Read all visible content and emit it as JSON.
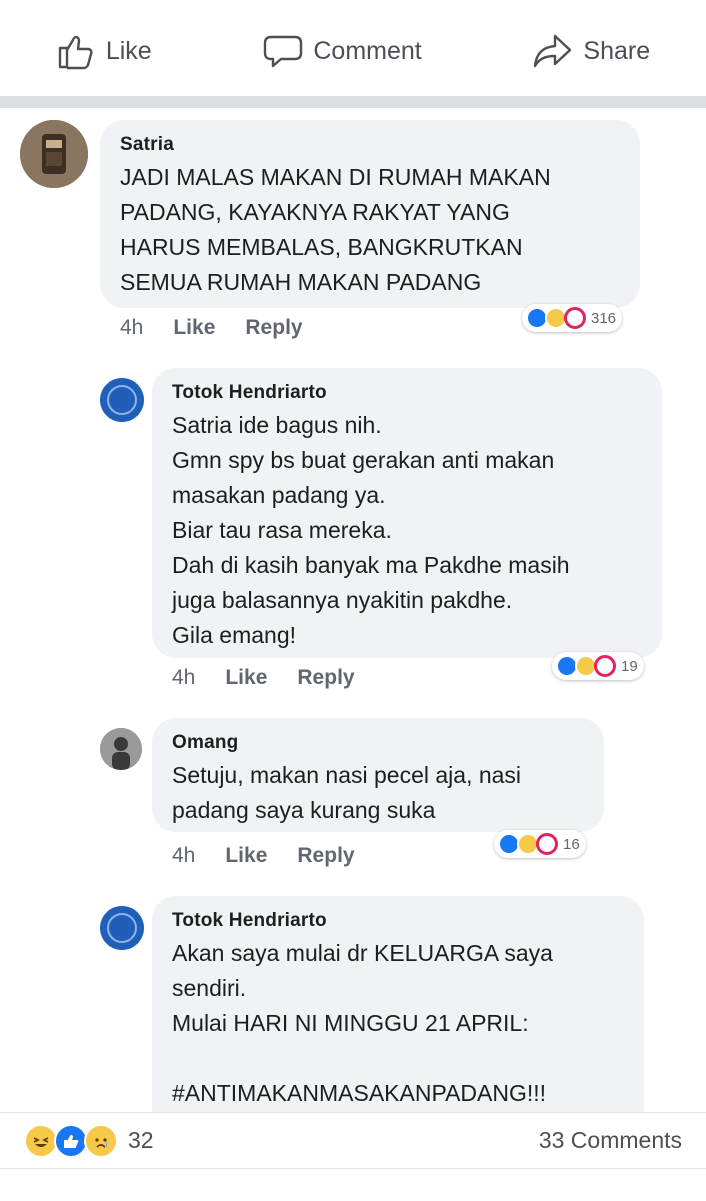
{
  "actions": {
    "like": "Like",
    "comment": "Comment",
    "share": "Share"
  },
  "comments": [
    {
      "author": "Satria",
      "text": "JADI MALAS MAKAN DI RUMAH MAKAN\nPADANG, KAYAKNYA RAKYAT YANG\nHARUS MEMBALAS, BANGKRUTKAN\nSEMUA RUMAH MAKAN PADANG",
      "time": "4h",
      "like": "Like",
      "reply": "Reply",
      "reactions": "316"
    },
    {
      "author": "Totok Hendriarto",
      "text": "Satria ide bagus nih.\nGmn spy bs buat gerakan anti makan\nmasakan padang ya.\nBiar tau rasa mereka.\nDah di kasih banyak ma Pakdhe masih\njuga balasannya nyakitin pakdhe.\nGila emang!",
      "time": "4h",
      "like": "Like",
      "reply": "Reply",
      "reactions": "19"
    },
    {
      "author": "Omang",
      "text": "Setuju, makan nasi pecel aja, nasi\npadang saya kurang suka",
      "time": "4h",
      "like": "Like",
      "reply": "Reply",
      "reactions": "16"
    },
    {
      "author": "Totok Hendriarto",
      "text": "Akan saya mulai dr KELUARGA saya\nsendiri.\nMulai HARI NI MINGGU 21 APRIL:\n\n#ANTIMAKANMASAKANPADANG!!!"
    }
  ],
  "summary": {
    "reaction_count": "32",
    "comments": "33 Comments"
  },
  "colors": {
    "like_blue": "#1877f2",
    "bubble_bg": "#f0f2f5",
    "meta_gray": "#606770"
  }
}
